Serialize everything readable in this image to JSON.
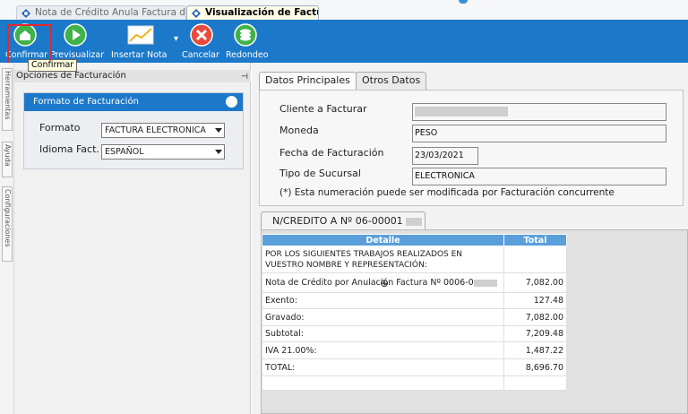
{
  "tabs": [
    {
      "label": "Nota de Crédito Anula Factura de ...",
      "active": false
    },
    {
      "label": "Visualización de Factura",
      "active": true
    }
  ],
  "toolbar": {
    "buttons": [
      {
        "label": "Confirmar",
        "icon": "home-icon"
      },
      {
        "label": "Previsualizar",
        "icon": "play-icon"
      },
      {
        "label": "Insertar Nota",
        "icon": "chart-icon"
      },
      {
        "label": "Cancelar",
        "icon": "close-icon"
      },
      {
        "label": "Redondeo",
        "icon": "stack-icon"
      }
    ],
    "tooltip": "Confirmar"
  },
  "side_tabs": [
    "Herramientas",
    "Ayuda",
    "Configuraciones"
  ],
  "left_panel": {
    "title": "Opciones de Facturación",
    "group_title": "Formato de Facturación",
    "formato_label": "Formato",
    "formato_value": "FACTURA ELECTRONICA",
    "idioma_label": "Idioma Fact.",
    "idioma_value": "ESPAÑOL"
  },
  "right": {
    "tabs": [
      "Datos Principales",
      "Otros Datos"
    ],
    "fields": {
      "cliente_label": "Cliente a Facturar",
      "cliente_value": "",
      "moneda_label": "Moneda",
      "moneda_value": "PESO",
      "fecha_label": "Fecha de Facturación",
      "fecha_value": "23/03/2021",
      "sucursal_label": "Tipo de Sucursal",
      "sucursal_value": "ELECTRONICA"
    },
    "note": "(*) Esta numeración puede ser modificada por Facturación concurrente",
    "nc_tab": "N/CREDITO A Nº 06-00001"
  },
  "table": {
    "headers": [
      "Detalle",
      "Total"
    ],
    "rows": [
      {
        "detalle": "POR LOS SIGUIENTES TRABAJOS REALIZADOS EN VUESTRO NOMBRE Y REPRESENTACIÓN:",
        "total": ""
      },
      {
        "detalle": "Nota de Crédito por Anulación Factura Nº 0006-0",
        "total": "7,082.00"
      },
      {
        "detalle": "Exento:",
        "total": "127.48"
      },
      {
        "detalle": "Gravado:",
        "total": "7,082.00"
      },
      {
        "detalle": "Subtotal:",
        "total": "7,209.48"
      },
      {
        "detalle": "IVA 21.00%:",
        "total": "1,487.22"
      },
      {
        "detalle": "TOTAL:",
        "total": "8,696.70"
      },
      {
        "detalle": "",
        "total": ""
      }
    ]
  },
  "colors": {
    "toolbar": "#1c79c9",
    "header_blue": "#5a9fd9",
    "highlight": "#e8262c"
  }
}
